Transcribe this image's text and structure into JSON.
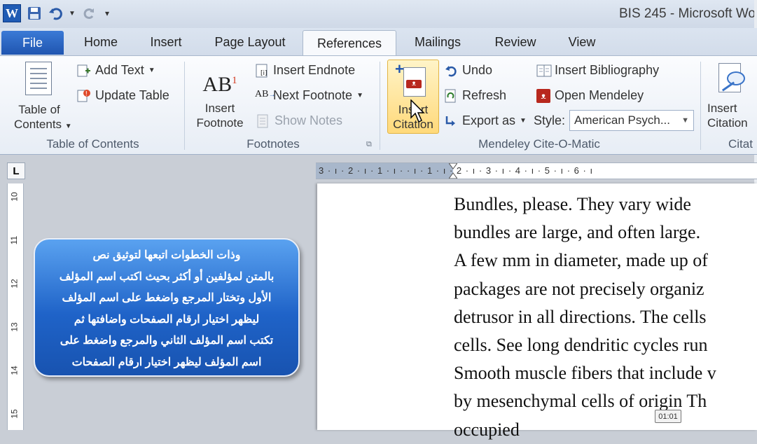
{
  "window": {
    "title": "BIS 245  -  Microsoft Wo"
  },
  "qat": {
    "logo": "W"
  },
  "tabs": [
    "File",
    "Home",
    "Insert",
    "Page Layout",
    "References",
    "Mailings",
    "Review",
    "View"
  ],
  "ribbon": {
    "toc": {
      "big_label_1": "Table of",
      "big_label_2": "Contents",
      "add_text": "Add Text",
      "update_table": "Update Table",
      "group": "Table of Contents"
    },
    "footnotes": {
      "big_label_1": "Insert",
      "big_label_2": "Footnote",
      "ab_glyph": "AB",
      "sup": "1",
      "insert_endnote": "Insert Endnote",
      "next_footnote": "Next Footnote",
      "show_notes": "Show Notes",
      "group": "Footnotes"
    },
    "mendeley": {
      "insert_citation_1": "Insert",
      "insert_citation_2": "Citation",
      "undo": "Undo",
      "refresh": "Refresh",
      "export_as": "Export as",
      "style_label": "Style:",
      "style_value": "American Psych...",
      "insert_bibliography": "Insert Bibliography",
      "open_mendeley": "Open Mendeley",
      "group": "Mendeley Cite-O-Matic"
    },
    "next_group": {
      "big_label_1": "Insert",
      "big_label_2": "Citation",
      "group": "Citat"
    }
  },
  "ruler": {
    "corner": "L",
    "text": "3 · ı · 2 · ı · 1 · ı ·   · ı · 1 · ı · 2 · ı · 3 · ı · 4 · ı · 5 · ı · 6 · ı",
    "vertical": [
      "10",
      "11",
      "12",
      "13",
      "14",
      "15"
    ]
  },
  "document": {
    "lines": [
      "Bundles, please. They vary wide",
      "bundles are large, and often large.",
      "A few mm in diameter, made up of",
      "packages are not precisely organiz",
      "detrusor in all directions. The cells",
      "cells. See long dendritic cycles run",
      "Smooth muscle fibers that include v",
      "by mesenchymal cells of origin Th",
      "occupied"
    ]
  },
  "callout": {
    "lines": [
      "وذات الخطوات اتبعها لتوثيق نص",
      "بالمتن لمؤلفين أو أكثر بحيث اكتب اسم المؤلف",
      "الأول وتختار المرجع واضغط على اسم المؤلف",
      "ليظهر اختيار ارقام الصفحات واضافتها ثم",
      "تكتب اسم المؤلف الثاني والمرجع واضغط على",
      "اسم المؤلف ليظهر اختيار ارقام الصفحات"
    ]
  },
  "video": {
    "timestamp": "01:01"
  }
}
